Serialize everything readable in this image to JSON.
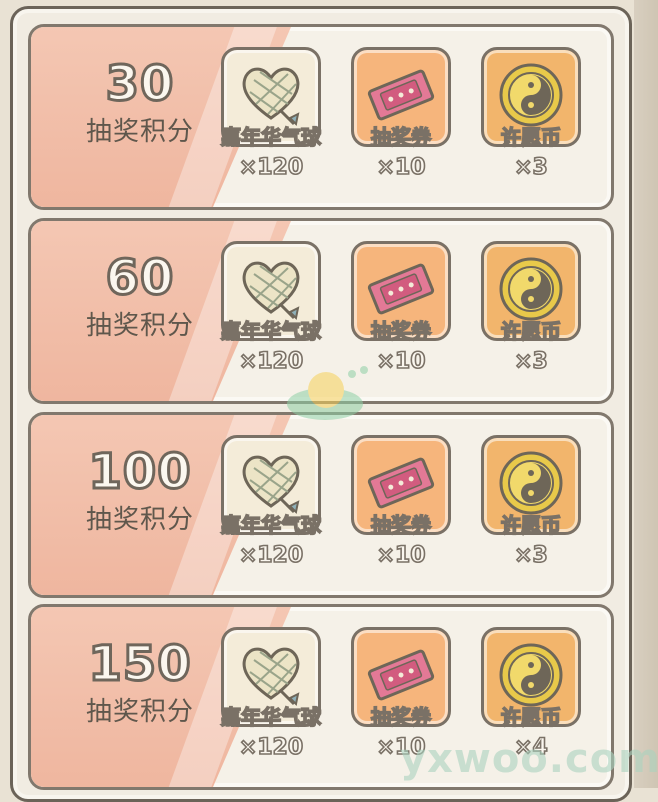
{
  "tiers": [
    {
      "points": "30",
      "points_label": "抽奖积分",
      "rewards": [
        {
          "name": "嘉年华气球",
          "qty": "×120",
          "icon": "heart-balloon-icon"
        },
        {
          "name": "抽奖券",
          "qty": "×10",
          "icon": "lottery-ticket-icon"
        },
        {
          "name": "许愿币",
          "qty": "×3",
          "icon": "wish-coin-icon"
        }
      ]
    },
    {
      "points": "60",
      "points_label": "抽奖积分",
      "rewards": [
        {
          "name": "嘉年华气球",
          "qty": "×120",
          "icon": "heart-balloon-icon"
        },
        {
          "name": "抽奖券",
          "qty": "×10",
          "icon": "lottery-ticket-icon"
        },
        {
          "name": "许愿币",
          "qty": "×3",
          "icon": "wish-coin-icon"
        }
      ]
    },
    {
      "points": "100",
      "points_label": "抽奖积分",
      "rewards": [
        {
          "name": "嘉年华气球",
          "qty": "×120",
          "icon": "heart-balloon-icon"
        },
        {
          "name": "抽奖券",
          "qty": "×10",
          "icon": "lottery-ticket-icon"
        },
        {
          "name": "许愿币",
          "qty": "×3",
          "icon": "wish-coin-icon"
        }
      ]
    },
    {
      "points": "150",
      "points_label": "抽奖积分",
      "rewards": [
        {
          "name": "嘉年华气球",
          "qty": "×120",
          "icon": "heart-balloon-icon"
        },
        {
          "name": "抽奖券",
          "qty": "×10",
          "icon": "lottery-ticket-icon"
        },
        {
          "name": "许愿币",
          "qty": "×4",
          "icon": "wish-coin-icon"
        }
      ]
    }
  ],
  "watermark": "yxwoo.com",
  "colors": {
    "row_wedge": "#efb69f",
    "balloon_frame": "#f4ecd9",
    "ticket_frame": "#f6b57c",
    "coin_frame": "#f2b56c"
  }
}
